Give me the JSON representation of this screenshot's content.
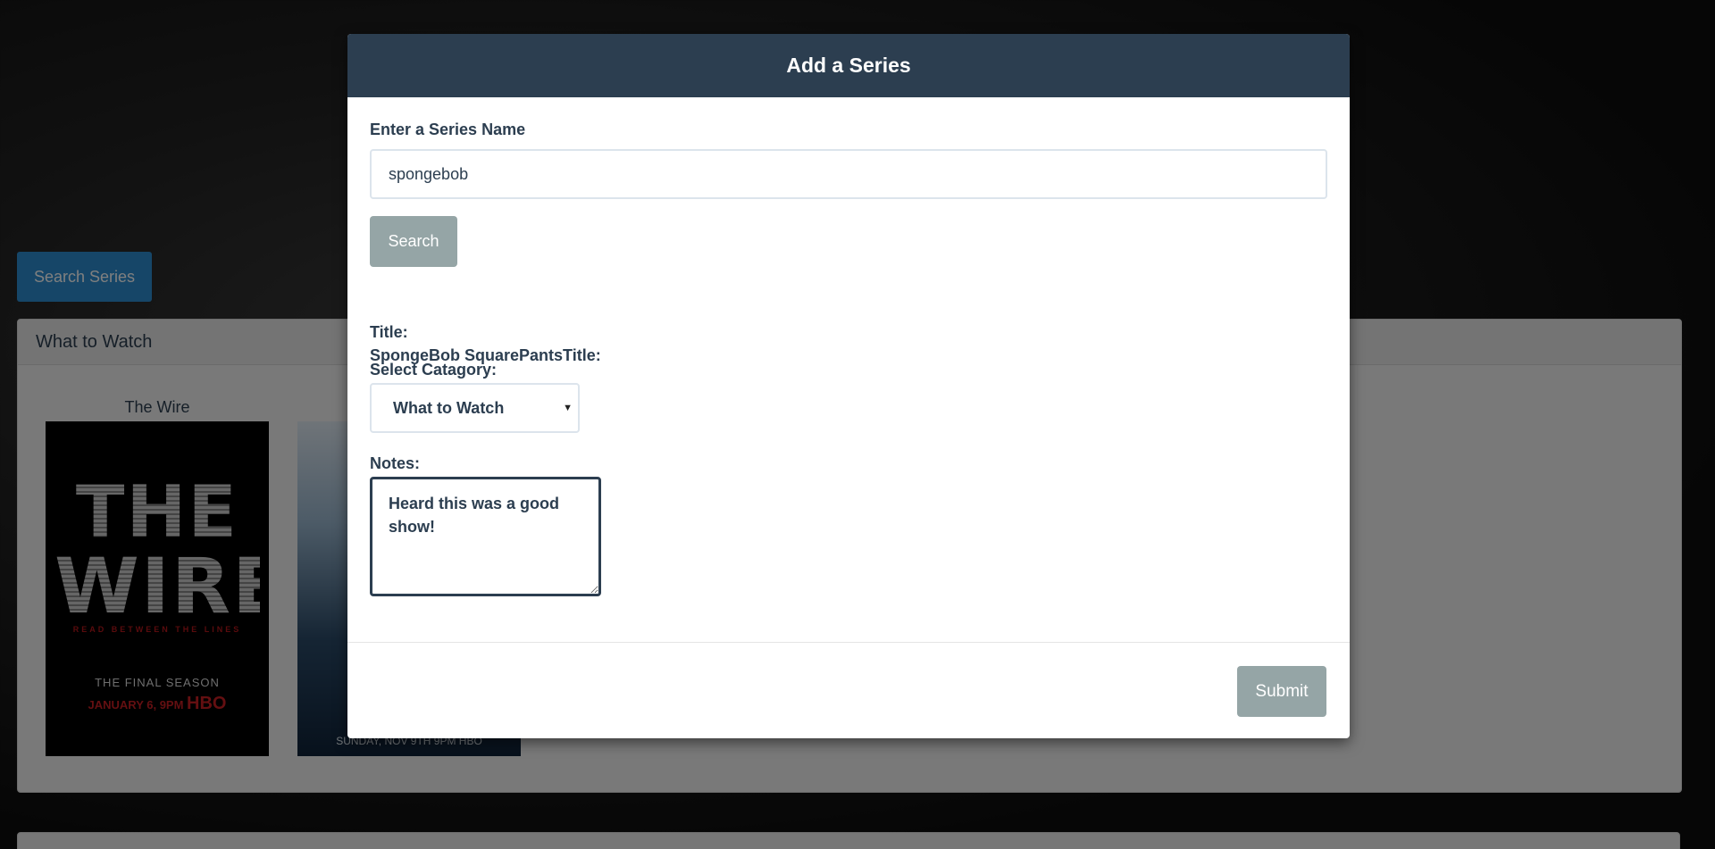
{
  "background": {
    "search_series_label": "Search Series",
    "panel": {
      "heading": "What to Watch",
      "shows": [
        {
          "title": "The Wire",
          "poster": {
            "line1": "THE",
            "line2": "WIRE",
            "tagline": "READ BETWEEN THE LINES",
            "season": "THE FINAL SEASON",
            "date": "JANUARY 6, 9PM",
            "network": "HBO"
          }
        },
        {
          "title": "",
          "poster": {
            "footer": "SUNDAY, NOV 9TH 9PM HBO"
          }
        }
      ]
    }
  },
  "modal": {
    "title": "Add a Series",
    "series_name_label": "Enter a Series Name",
    "series_name_value": "spongebob",
    "search_label": "Search",
    "result_title_label": "Title:",
    "result_line": "SpongeBob SquarePantsTitle:",
    "category_label": "Select Catagory:",
    "category_selected": "What to Watch",
    "notes_label": "Notes:",
    "notes_value": "Heard this was a good show!",
    "submit_label": "Submit"
  },
  "colors": {
    "header": "#2c3e50",
    "primary_button": "#2c8dd0",
    "muted_button": "#95a5a6"
  }
}
